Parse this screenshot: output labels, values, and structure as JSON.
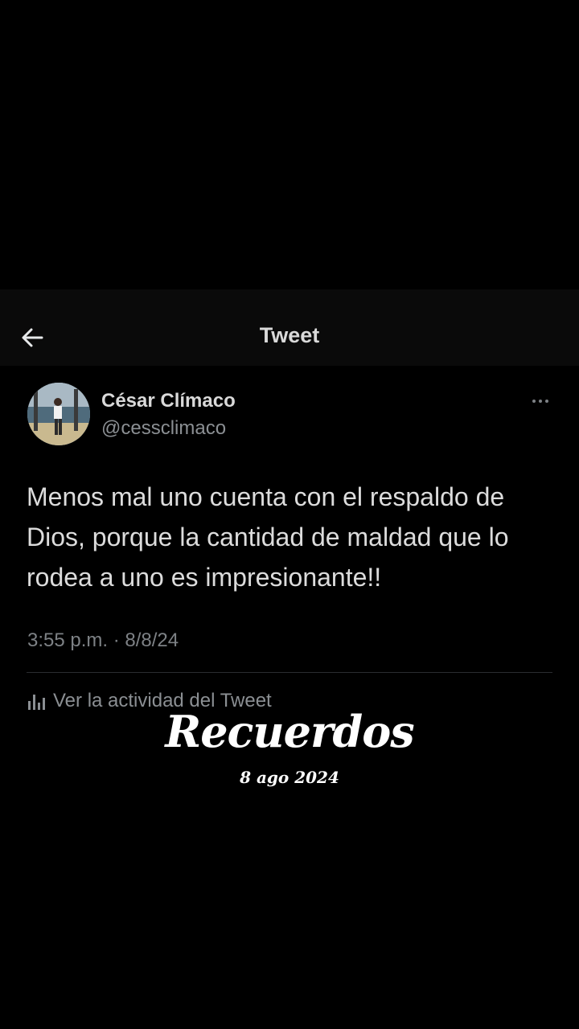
{
  "header": {
    "title": "Tweet",
    "back_icon": "arrow-left-icon"
  },
  "tweet": {
    "author_name": "César Clímaco",
    "author_handle": "@cessclimaco",
    "more_icon": "more-horizontal-icon",
    "text": "Menos mal uno cuenta con el respaldo de Dios, porque la cantidad de maldad que lo rodea a uno es impresionante!!",
    "timestamp": "3:55 p.m. · 8/8/24",
    "activity_icon": "bar-chart-icon",
    "activity_label": "Ver la actividad del Tweet"
  },
  "overlay": {
    "title": "Recuerdos",
    "date": "8 ago 2024"
  },
  "colors": {
    "background": "#000000",
    "header_bg": "#0a0a0a",
    "primary_text": "#d9d9d9",
    "secondary_text": "#8b8f93",
    "divider": "#2a2d30",
    "overlay_text": "#ffffff"
  }
}
